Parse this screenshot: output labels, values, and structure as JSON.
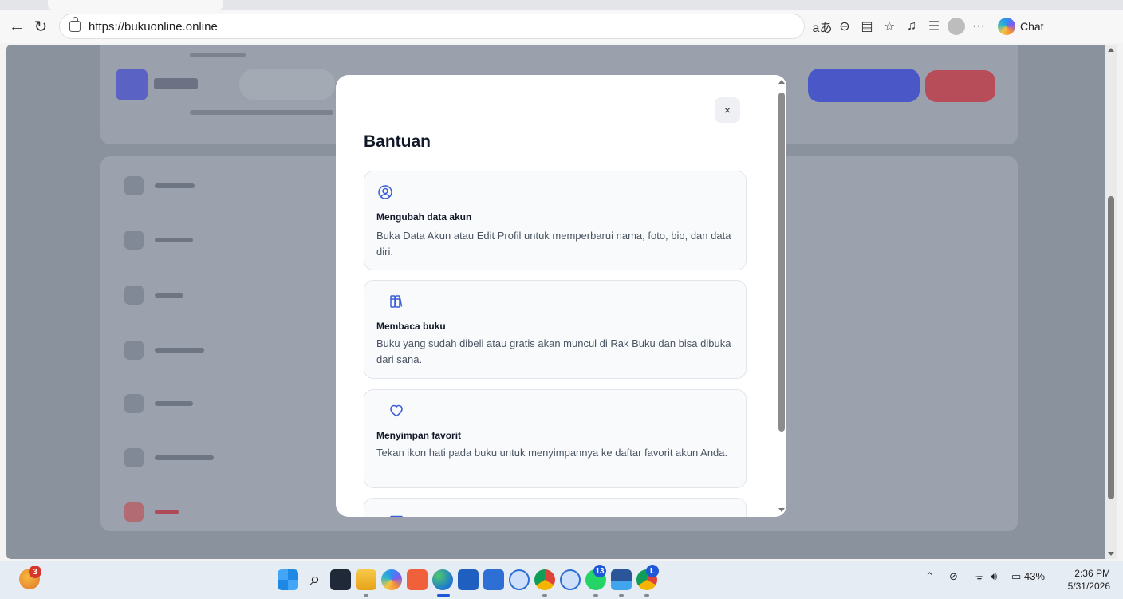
{
  "browser": {
    "url": "https://bukuonline.online",
    "chat_label": "Chat"
  },
  "modal": {
    "title": "Bantuan",
    "close_label": "×",
    "cards": [
      {
        "icon": "user-circle-icon",
        "title": "Mengubah data akun",
        "description": "Buka Data Akun atau Edit Profil untuk memperbarui nama, foto, bio, dan data diri."
      },
      {
        "icon": "books-icon",
        "title": "Membaca buku",
        "description": "Buku yang sudah dibeli atau gratis akan muncul di Rak Buku dan bisa dibuka dari sana."
      },
      {
        "icon": "heart-icon",
        "title": "Menyimpan favorit",
        "description": "Tekan ikon hati pada buku untuk menyimpannya ke daftar favorit akun Anda."
      },
      {
        "icon": "mail-icon"
      }
    ]
  },
  "taskbar": {
    "weather_badge": "3",
    "whatsapp_badge": "13",
    "chrome_badge": "L",
    "battery": "43%",
    "time": "2:36 PM",
    "date": "5/31/2026"
  },
  "colors": {
    "accent": "#3b5bd9",
    "overlay": "#8a929e"
  }
}
